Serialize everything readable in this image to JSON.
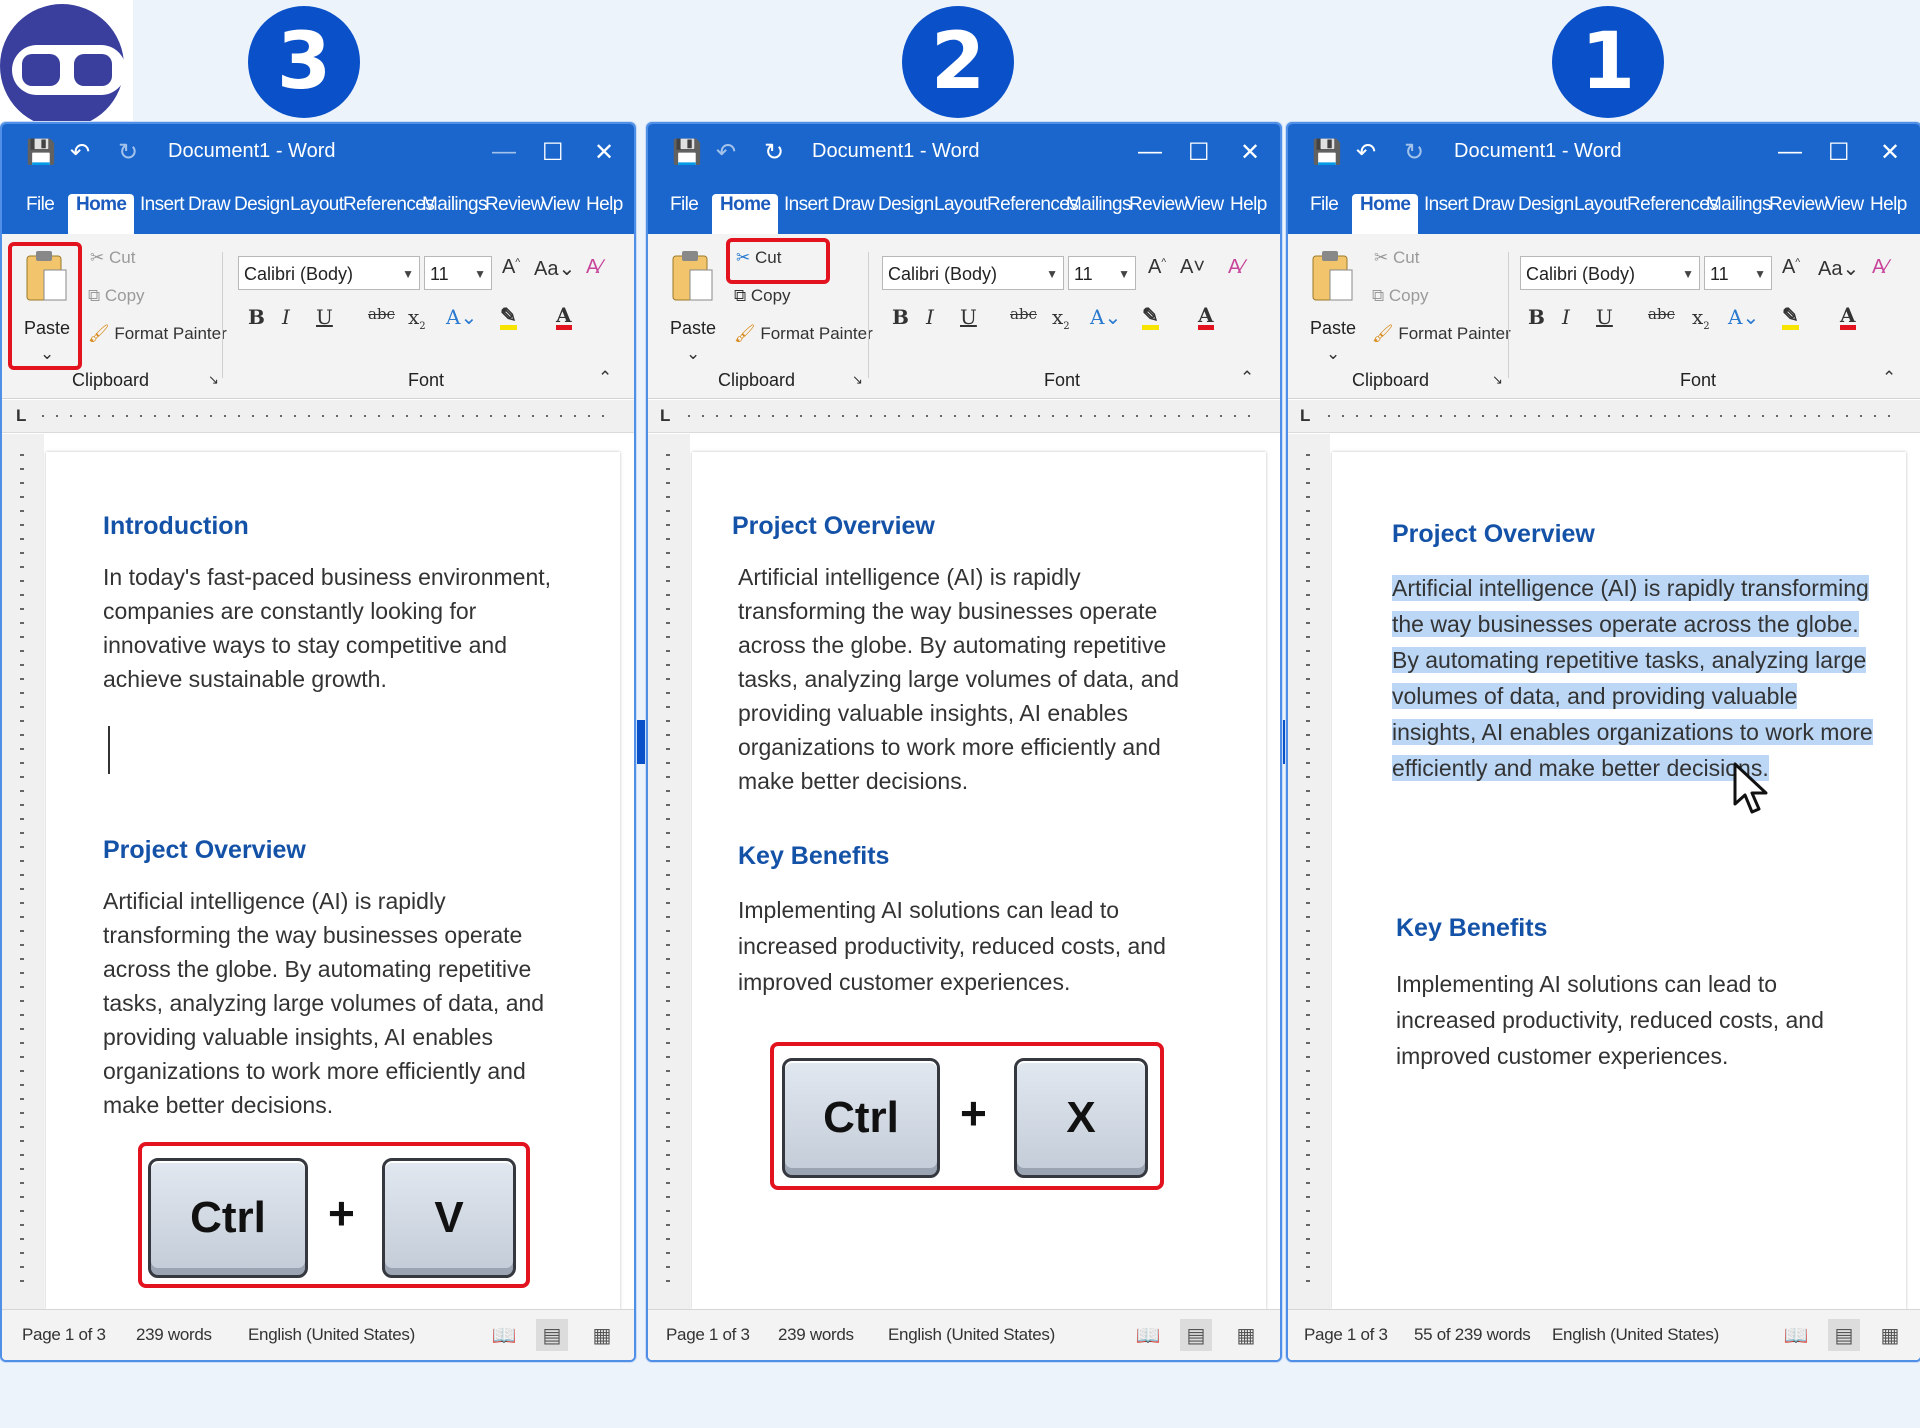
{
  "steps": [
    "3",
    "2",
    "1"
  ],
  "window": {
    "title": "Document1 - Word",
    "tabs": [
      "File",
      "Home",
      "Insert",
      "Draw",
      "Design",
      "Layout",
      "References",
      "Mailings",
      "Review",
      "View",
      "Help"
    ]
  },
  "ribbon": {
    "paste": "Paste",
    "cut": "Cut",
    "copy": "Copy",
    "format_painter": "Format Painter",
    "clipboard_group": "Clipboard",
    "font_group": "Font",
    "font_name": "Calibri (Body)",
    "font_size": "11"
  },
  "panel3": {
    "heading1": "Introduction",
    "intro": "In today's fast-paced business environment, companies are constantly looking for innovative ways to stay competitive and achieve sustainable growth.",
    "heading2": "Project Overview",
    "overview": "Artificial intelligence (AI) is rapidly transforming the way businesses operate across the globe. By automating repetitive tasks, analyzing large volumes of data, and providing valuable insights, AI enables organizations to work more efficiently and make better decisions.",
    "key1": "Ctrl",
    "plus": "+",
    "key2": "V",
    "status_page": "Page 1 of 3",
    "status_words": "239 words",
    "status_lang": "English (United States)"
  },
  "panel2": {
    "heading1": "Project Overview",
    "overview": "Artificial intelligence (AI) is rapidly transforming the way businesses operate across the globe. By automating repetitive tasks, analyzing large volumes of data, and providing valuable insights, AI enables organizations to work more efficiently and make better decisions.",
    "heading2": "Key Benefits",
    "benefits": "Implementing AI solutions can lead to increased productivity, reduced costs, and improved customer experiences.",
    "key1": "Ctrl",
    "plus": "+",
    "key2": "X",
    "status_page": "Page 1 of 3",
    "status_words": "239 words",
    "status_lang": "English (United States)"
  },
  "panel1": {
    "heading1": "Project Overview",
    "overview": "Artificial intelligence (AI) is rapidly transforming the way businesses operate across the globe. By automating repetitive tasks, analyzing large volumes of data, and providing valuable insights, AI enables organizations to work more efficiently and make better decisions.",
    "heading2": "Key Benefits",
    "benefits": "Implementing AI solutions can lead to increased productivity, reduced costs, and improved customer experiences.",
    "status_page": "Page 1 of 3",
    "status_words": "55 of 239 words",
    "status_lang": "English (United States)"
  },
  "colors": {
    "accent": "#1a66cc",
    "highlight": "#e2121e",
    "selection": "#bcd7f5",
    "heading": "#1452a8"
  }
}
